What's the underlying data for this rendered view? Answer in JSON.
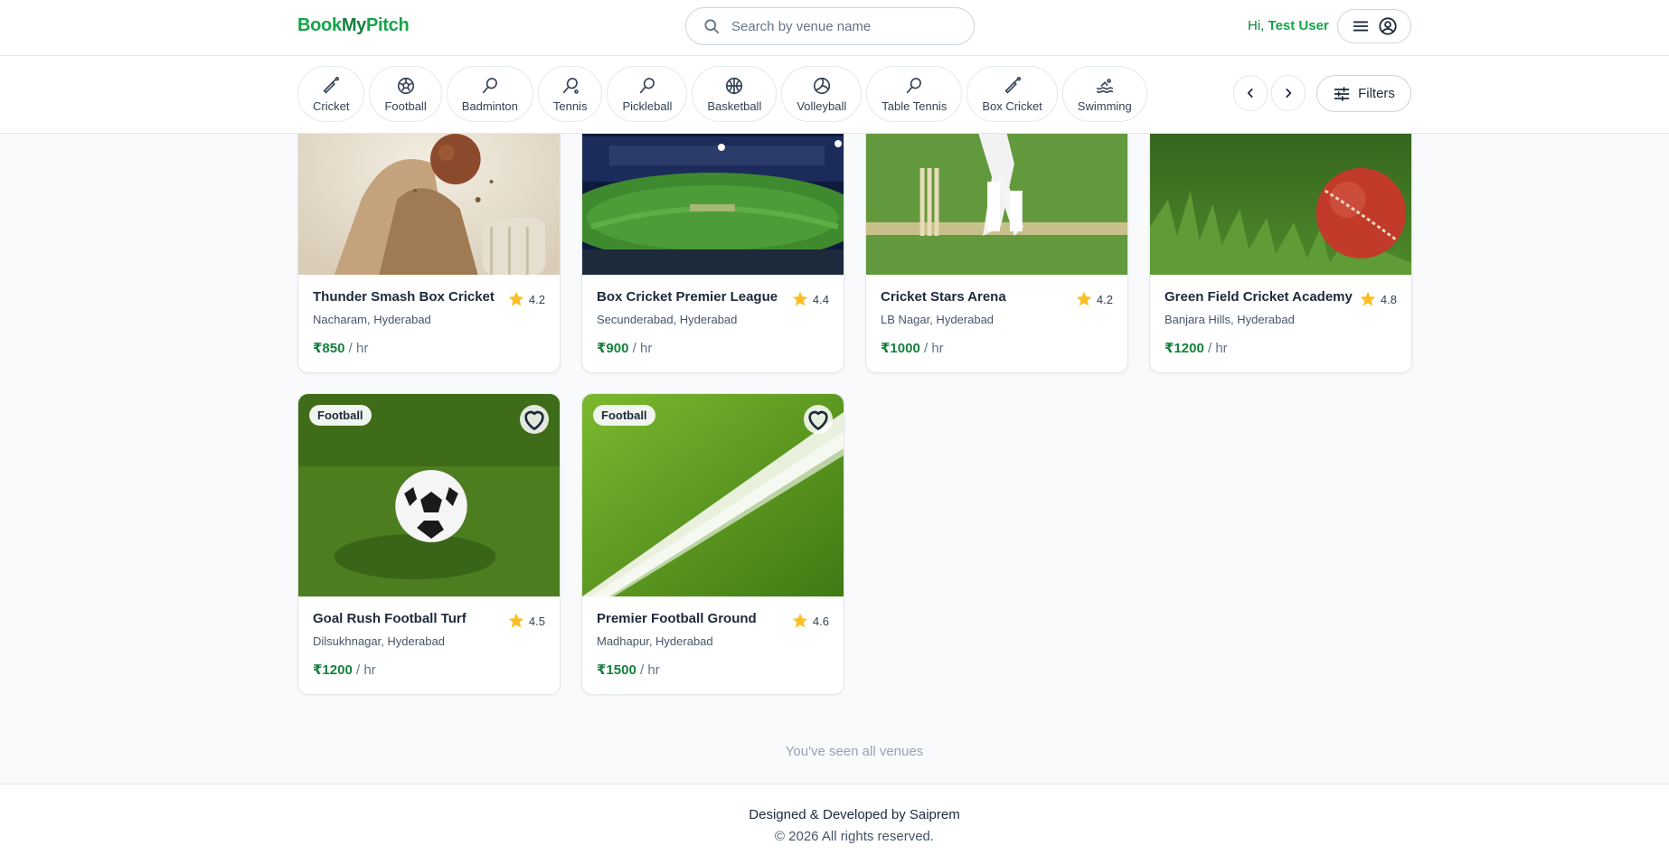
{
  "header": {
    "logo_a": "Book",
    "logo_b": "My",
    "logo_c": "Pitch",
    "search_placeholder": "Search by venue name",
    "greeting": "Hi,",
    "user_name": "Test User"
  },
  "categories": [
    {
      "label": "Cricket",
      "icon": "cricket-bat-icon"
    },
    {
      "label": "Football",
      "icon": "football-icon"
    },
    {
      "label": "Badminton",
      "icon": "badminton-racket-icon"
    },
    {
      "label": "Tennis",
      "icon": "tennis-racket-icon"
    },
    {
      "label": "Pickleball",
      "icon": "pickleball-paddle-icon"
    },
    {
      "label": "Basketball",
      "icon": "basketball-icon"
    },
    {
      "label": "Volleyball",
      "icon": "volleyball-icon"
    },
    {
      "label": "Table Tennis",
      "icon": "table-tennis-icon"
    },
    {
      "label": "Box Cricket",
      "icon": "box-cricket-icon"
    },
    {
      "label": "Swimming",
      "icon": "swimming-icon"
    }
  ],
  "filters_label": "Filters",
  "venues": [
    {
      "name": "Thunder Smash Box Cricket",
      "rating": "4.2",
      "location": "Nacharam, Hyderabad",
      "price": "₹850",
      "unit": "/ hr"
    },
    {
      "name": "Box Cricket Premier League",
      "rating": "4.4",
      "location": "Secunderabad, Hyderabad",
      "price": "₹900",
      "unit": "/ hr"
    },
    {
      "name": "Cricket Stars Arena",
      "rating": "4.2",
      "location": "LB Nagar, Hyderabad",
      "price": "₹1000",
      "unit": "/ hr"
    },
    {
      "name": "Green Field Cricket Academy",
      "rating": "4.8",
      "location": "Banjara Hills, Hyderabad",
      "price": "₹1200",
      "unit": "/ hr"
    },
    {
      "name": "Goal Rush Football Turf",
      "rating": "4.5",
      "location": "Dilsukhnagar, Hyderabad",
      "price": "₹1200",
      "unit": "/ hr",
      "tag": "Football"
    },
    {
      "name": "Premier Football Ground",
      "rating": "4.6",
      "location": "Madhapur, Hyderabad",
      "price": "₹1500",
      "unit": "/ hr",
      "tag": "Football"
    }
  ],
  "end_message": "You've seen all venues",
  "footer": {
    "credit": "Designed & Developed by Saiprem",
    "copyright": "© 2026 All rights reserved."
  },
  "colors": {
    "brand": "#16a34a",
    "price": "#15803d",
    "star": "#fbbf24"
  }
}
